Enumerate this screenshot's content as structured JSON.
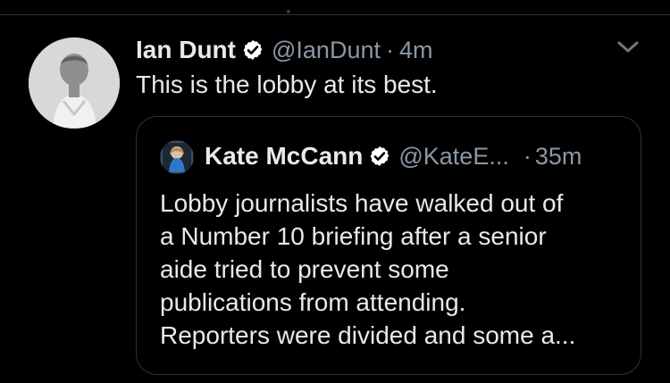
{
  "tweet": {
    "author": {
      "name": "Ian Dunt",
      "handle": "@IanDunt",
      "verified": true
    },
    "separator": "·",
    "timestamp": "4m",
    "text": "This is the lobby at its best.",
    "quoted_tweet": {
      "author": {
        "name": "Kate McCann",
        "handle": "@KateE...",
        "verified": true
      },
      "separator": "·",
      "timestamp": "35m",
      "lines": [
        "Lobby journalists have walked out of",
        "a Number 10 briefing after a senior",
        "aide tried to prevent some",
        "publications from attending.",
        "Reporters were divided and some a..."
      ]
    }
  },
  "icons": {
    "verified": "verified-badge-icon",
    "menu": "chevron-down-icon"
  },
  "colors": {
    "background": "#000000",
    "text_primary": "#e7e9ea",
    "text_secondary": "#8b98a5",
    "border": "#2f3336",
    "verified_badge": "#ffffff"
  }
}
